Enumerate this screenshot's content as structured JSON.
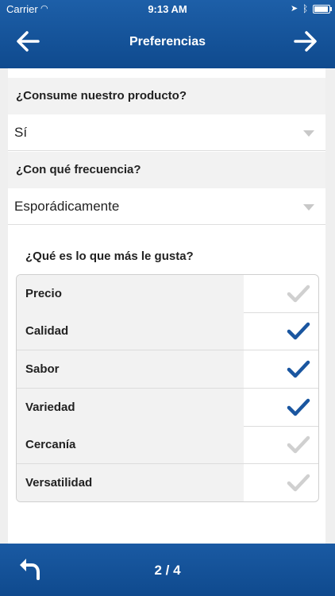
{
  "status_bar": {
    "carrier": "Carrier",
    "time": "9:13 AM"
  },
  "header": {
    "title": "Preferencias",
    "back_icon": "arrow-left-icon",
    "next_icon": "arrow-right-icon"
  },
  "questions": [
    {
      "label": "¿Consume nuestro producto?",
      "value": "Sí"
    },
    {
      "label": "¿Con qué frecuencia?",
      "value": "Esporádicamente"
    }
  ],
  "preferences": {
    "question": "¿Qué es lo que más le gusta?",
    "options": [
      {
        "label": "Precio",
        "checked": false
      },
      {
        "label": "Calidad",
        "checked": true
      },
      {
        "label": "Sabor",
        "checked": true
      },
      {
        "label": "Variedad",
        "checked": true
      },
      {
        "label": "Cercanía",
        "checked": false
      },
      {
        "label": "Versatilidad",
        "checked": false
      }
    ]
  },
  "footer": {
    "pager": "2 / 4",
    "undo_icon": "undo-icon"
  },
  "colors": {
    "accent": "#0f4a8e",
    "check_on": "#1a56a0",
    "check_off": "#d0d0d0"
  }
}
